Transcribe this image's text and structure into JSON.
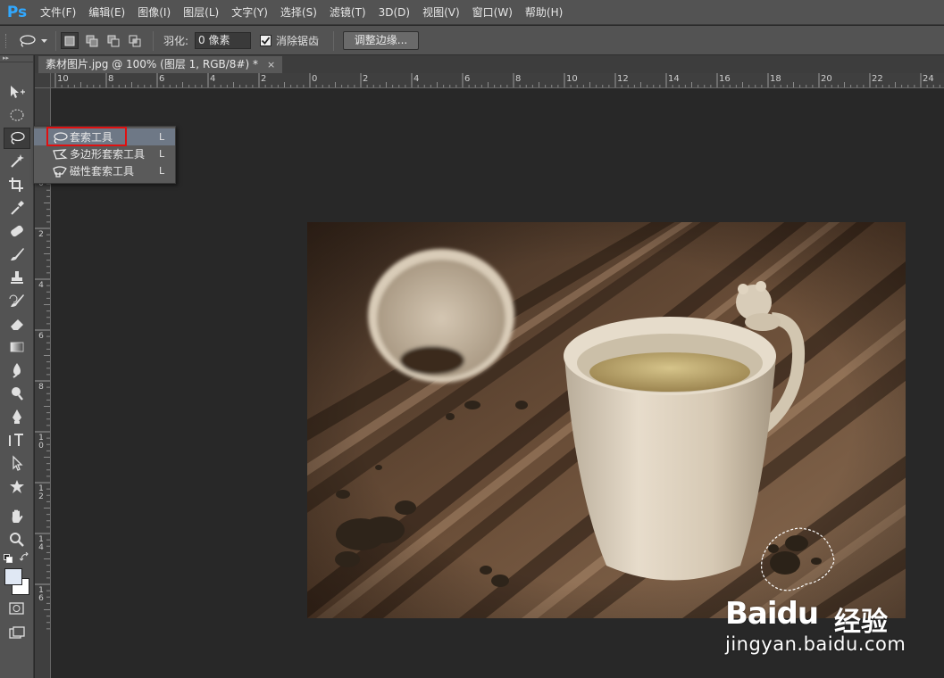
{
  "app": {
    "logo": "Ps"
  },
  "menu": [
    "文件(F)",
    "编辑(E)",
    "图像(I)",
    "图层(L)",
    "文字(Y)",
    "选择(S)",
    "滤镜(T)",
    "3D(D)",
    "视图(V)",
    "窗口(W)",
    "帮助(H)"
  ],
  "options": {
    "feather_label": "羽化:",
    "feather_value": "0 像素",
    "antialias_label": "消除锯齿",
    "antialias_checked": true,
    "refine_edge_label": "调整边缘..."
  },
  "document": {
    "tab_title": "素材图片.jpg @ 100% (图层 1, RGB/8#) *",
    "close_glyph": "×"
  },
  "rulers": {
    "top_labels": [
      "10",
      "8",
      "6",
      "4",
      "2",
      "0",
      "2",
      "4",
      "6",
      "8",
      "10",
      "12",
      "14",
      "16",
      "18",
      "20",
      "22",
      "24"
    ],
    "left_labels": [
      "2",
      "0",
      "2",
      "4",
      "6",
      "8",
      "10",
      "12",
      "14",
      "16"
    ]
  },
  "toolbar": {
    "icons": [
      "move-tool-icon",
      "marquee-tool-icon",
      "lasso-tool-icon",
      "magic-wand-tool-icon",
      "crop-tool-icon",
      "eyedropper-tool-icon",
      "healing-brush-tool-icon",
      "brush-tool-icon",
      "clone-stamp-tool-icon",
      "history-brush-tool-icon",
      "eraser-tool-icon",
      "gradient-tool-icon",
      "blur-tool-icon",
      "dodge-tool-icon",
      "pen-tool-icon",
      "type-tool-icon",
      "path-selection-tool-icon",
      "custom-shape-tool-icon",
      "hand-tool-icon",
      "zoom-tool-icon"
    ],
    "active_tool": "lasso-tool-icon",
    "foreground_color": "#e0e8f4",
    "background_color": "#ffffff"
  },
  "flyout": {
    "items": [
      {
        "label": "套索工具",
        "key": "L",
        "icon": "lasso-icon",
        "selected": true
      },
      {
        "label": "多边形套索工具",
        "key": "L",
        "icon": "polygonal-lasso-icon",
        "selected": false
      },
      {
        "label": "磁性套索工具",
        "key": "L",
        "icon": "magnetic-lasso-icon",
        "selected": false
      }
    ],
    "highlight_color": "#e01010"
  },
  "watermark": {
    "brand": "Baidu",
    "product": "经验",
    "url": "jingyan.baidu.com"
  },
  "colors": {
    "chrome": "#535353",
    "canvas_bg": "#282828",
    "accent": "#31a8ff"
  }
}
